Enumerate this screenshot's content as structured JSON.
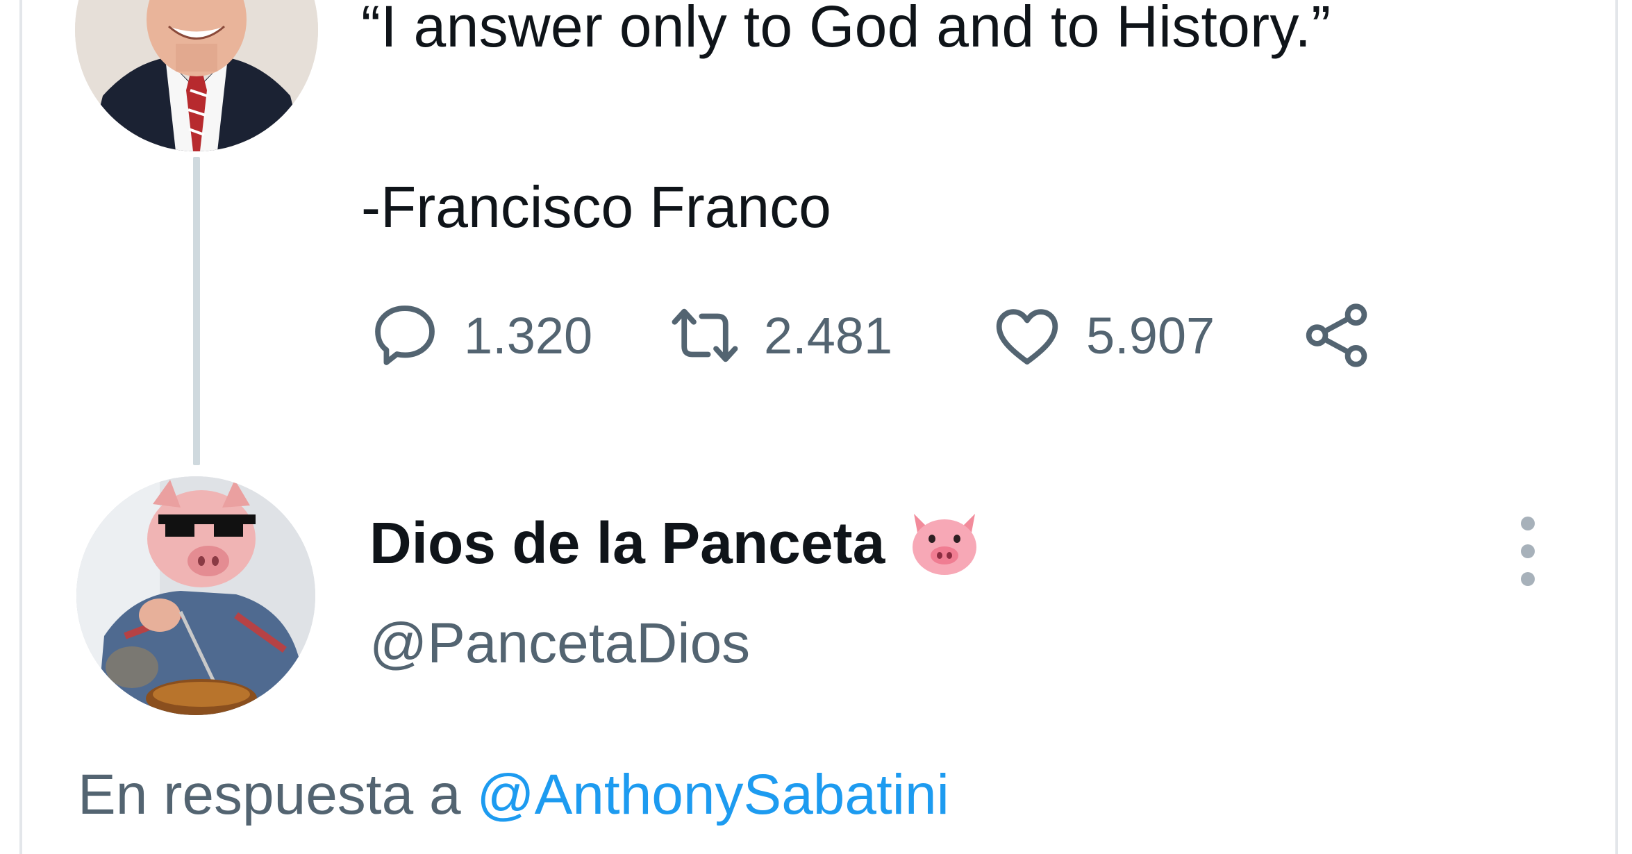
{
  "first_tweet": {
    "author_avatar": "man-in-suit-avatar",
    "quote": "“I answer only to God and to History.”",
    "attribution": "-Francisco Franco",
    "actions": {
      "replies": "1.320",
      "retweets": "2.481",
      "likes": "5.907"
    }
  },
  "second_tweet": {
    "author_avatar": "pig-with-sunglasses-avatar",
    "display_name": "Dios de la Panceta",
    "name_emoji": "pig-face-icon",
    "handle": "@PancetaDios",
    "reply_prefix": "En respuesta a",
    "reply_mention": "@AnthonySabatini"
  },
  "colors": {
    "text_primary": "#0f1419",
    "text_secondary": "#536471",
    "link": "#1d9bf0",
    "thread_line": "#cfd9de",
    "border": "#e3e6ea"
  }
}
